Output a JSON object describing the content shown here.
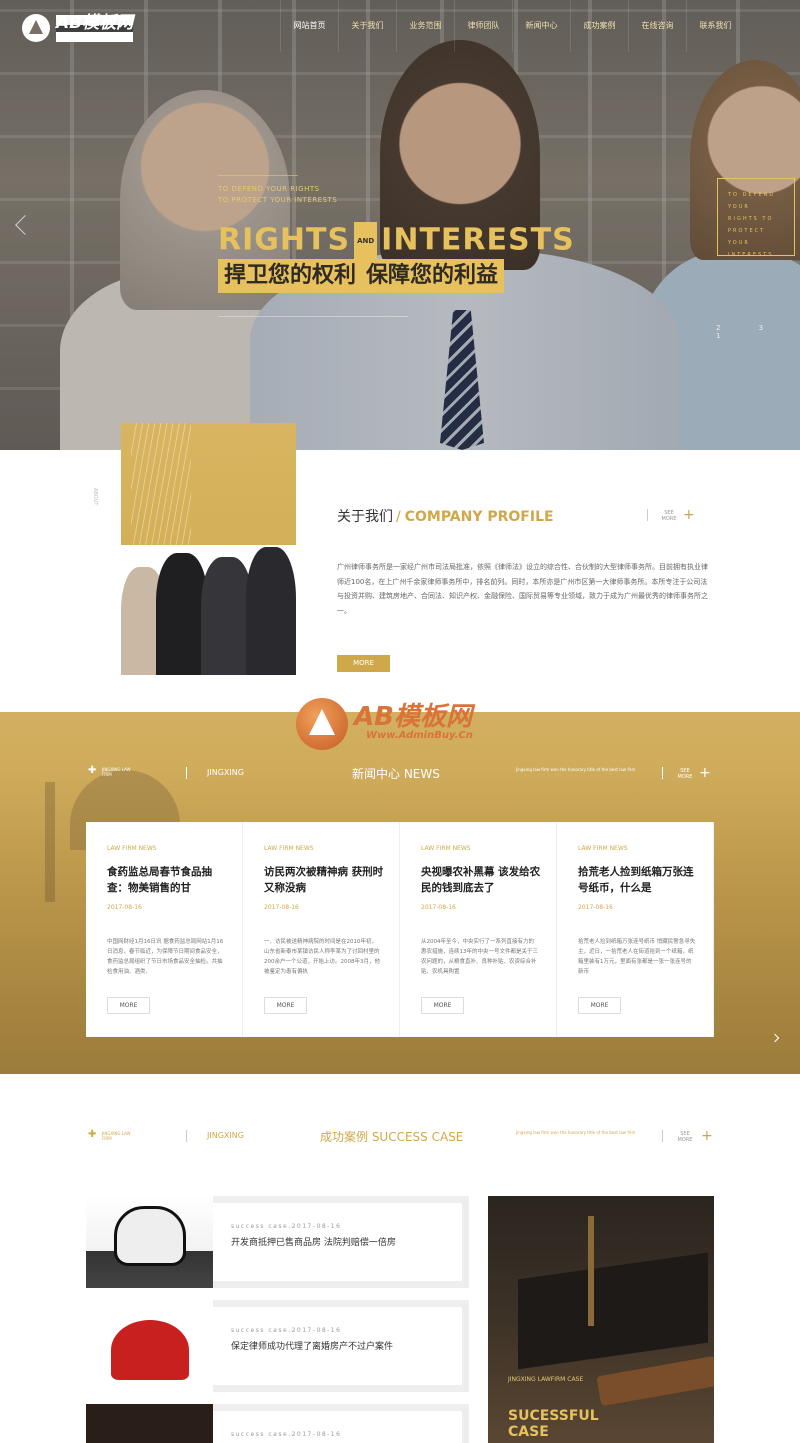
{
  "nav": {
    "logo_title": "AB模板网",
    "logo_url": "Www.AdminBuy.Cn",
    "items": [
      "网站首页",
      "关于我们",
      "业务范围",
      "律师团队",
      "新闻中心",
      "成功案例",
      "在线咨询",
      "联系我们"
    ]
  },
  "hero": {
    "sub1": "TO DEFEND YOUR RIGHTS",
    "sub2": "TO PROTECT YOUR INTERESTS",
    "big_left": "RIGHTS",
    "and": "AND",
    "big_right": "INTERESTS",
    "cn_left": "捍卫您的权利",
    "cn_right": "保障您的利益",
    "box_text": "TO DEFEND YOUR RIGHTS TO PROTECT YOUR INTERESTS",
    "dots": "2 3 1"
  },
  "about": {
    "title_cn": "关于我们",
    "sep": "/",
    "title_en": "COMPANY PROFILE",
    "see_more": "SEE MORE",
    "plus": "+",
    "text": "广州律师事务所是一家经广州市司法局批准，依照《律师法》设立的综合性、合伙制的大型律师事务所。目前拥有执业律师近100名，在上广州千余家律师事务所中，排名前列。同时，本所亦是广州市区第一大律师事务所。本所专注于公司法与投资并购、建筑房地产、合同法、知识产权、金融保险、国际贸易等专业领域，致力于成为广州最优秀的律师事务所之一。",
    "more": "MORE"
  },
  "watermark": {
    "title": "AB模板网",
    "url": "Www.AdminBuy.Cn"
  },
  "news": {
    "small": "JINGXING LAW FIRM",
    "tag": "JINGXING",
    "title": "新闻中心 NEWS",
    "desc": "Jingxing law firm won the honorary title of the best law firm",
    "see_more": "SEE MORE",
    "cards": [
      {
        "cat": "LAW FIRM NEWS",
        "title": "食药监总局春节食品抽查：物美销售的甘",
        "date": "2017-08-16",
        "text": "中国网财经1月16日讯 据食药监总局网站1月16日消息，春节临近，为保障节日期间食品安全，食药监总局组织了节日市场食品安全抽检。共抽检食用油、酒类、",
        "more": "MORE"
      },
      {
        "cat": "LAW FIRM NEWS",
        "title": "访民两次被精神病 获刑时又称没病",
        "date": "2017-08-16",
        "text": "一、访民被送精神病院的时间是在2010年初，山东省新泰市某镇访民人称李某为了讨回村里的200余户一个公道，开始上访。2008年3月，他被鉴定为患有偏执",
        "more": "MORE"
      },
      {
        "cat": "LAW FIRM NEWS",
        "title": "央视曝农补黑幕 该发给农民的钱到底去了",
        "date": "2017-08-16",
        "text": "从2004年至今，中央实行了一系列直接有力的惠农措施，连续13年的中央一号文件都是关于三农问题的，从粮食直补、良种补贴、农资综合补贴、农机具购置",
        "more": "MORE"
      },
      {
        "cat": "LAW FIRM NEWS",
        "title": "拾荒老人捡到纸箱万张连号纸币，什么是",
        "date": "2017-08-16",
        "text": "拾荒老人捡到纸箱万张连号纸币 悄藏民警急寻失主，近日，一拾荒老人在街道拾到一个纸箱，纸箱里装有1万元，里面有张都是一张一张连号的新币",
        "more": "MORE"
      }
    ]
  },
  "cases": {
    "small": "JINGXING LAW FIRM",
    "tag": "JINGXING",
    "title": "成功案例 SUCCESS CASE",
    "desc": "Jingxing law firm won the honorary title of the best law firm",
    "see_more": "SEE MORE",
    "rows": [
      {
        "date": "success case.2017-08-16",
        "title": "开发商抵押已售商品房 法院判赔偿一倍房"
      },
      {
        "date": "success case.2017-08-16",
        "title": "保定律师成功代理了离婚房产不过户案件"
      },
      {
        "date": "success case.2017-08-16",
        "title": ""
      }
    ],
    "big_label": "JINGXING LAWFIRM CASE",
    "big_title1": "SUCESSFUL",
    "big_title2": "CASE"
  },
  "colors": {
    "accent": "#d0a84a",
    "gold": "#e6c15d"
  }
}
